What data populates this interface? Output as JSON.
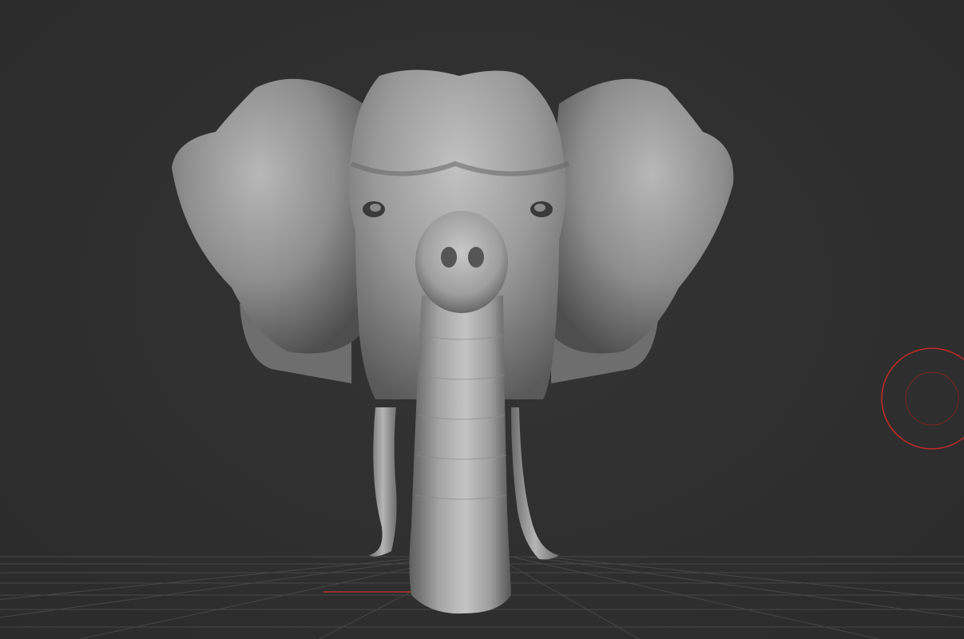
{
  "app": {
    "viewport_background": "#2e2e2e"
  },
  "model": {
    "subject": "elephant-head",
    "material_color": "#9a9a9a"
  },
  "floor_grid": {
    "visible": true,
    "line_color": "#4a4a4a",
    "axis_color": "#b33030"
  },
  "brush_cursor": {
    "color": "#c02a2a",
    "icon": "brush-circle-icon"
  }
}
